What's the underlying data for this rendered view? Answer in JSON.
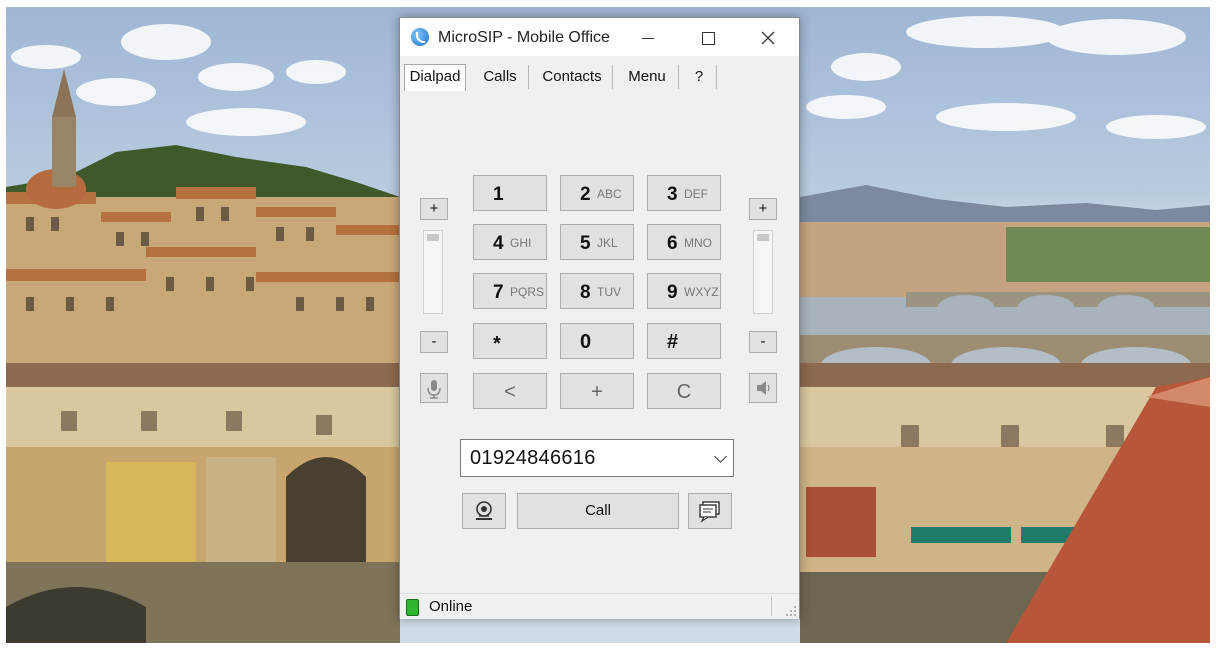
{
  "window": {
    "title": "MicroSIP - Mobile Office",
    "controls": [
      "minimize",
      "maximize",
      "close"
    ]
  },
  "tabs": [
    {
      "label": "Dialpad",
      "active": true
    },
    {
      "label": "Calls",
      "active": false
    },
    {
      "label": "Contacts",
      "active": false
    },
    {
      "label": "Menu",
      "active": false
    },
    {
      "label": "?",
      "active": false
    }
  ],
  "dialpad": {
    "keys": [
      {
        "digit": "1",
        "letters": ""
      },
      {
        "digit": "2",
        "letters": "ABC"
      },
      {
        "digit": "3",
        "letters": "DEF"
      },
      {
        "digit": "4",
        "letters": "GHI"
      },
      {
        "digit": "5",
        "letters": "JKL"
      },
      {
        "digit": "6",
        "letters": "MNO"
      },
      {
        "digit": "7",
        "letters": "PQRS"
      },
      {
        "digit": "8",
        "letters": "TUV"
      },
      {
        "digit": "9",
        "letters": "WXYZ"
      },
      {
        "digit": "*",
        "letters": ""
      },
      {
        "digit": "0",
        "letters": ""
      },
      {
        "digit": "#",
        "letters": ""
      },
      {
        "digit": "<",
        "letters": ""
      },
      {
        "digit": "+",
        "letters": ""
      },
      {
        "digit": "C",
        "letters": ""
      }
    ]
  },
  "volume": {
    "mic_plus": "+",
    "mic_minus": "-",
    "speaker_plus": "+",
    "speaker_minus": "-",
    "mic_icon": "microphone-icon",
    "speaker_icon": "speaker-icon"
  },
  "number_input": {
    "value": "01924846616"
  },
  "actions": {
    "call_label": "Call",
    "video_icon": "webcam-icon",
    "message_icon": "message-icon"
  },
  "status": {
    "text": "Online",
    "color": "#2fb52f"
  }
}
